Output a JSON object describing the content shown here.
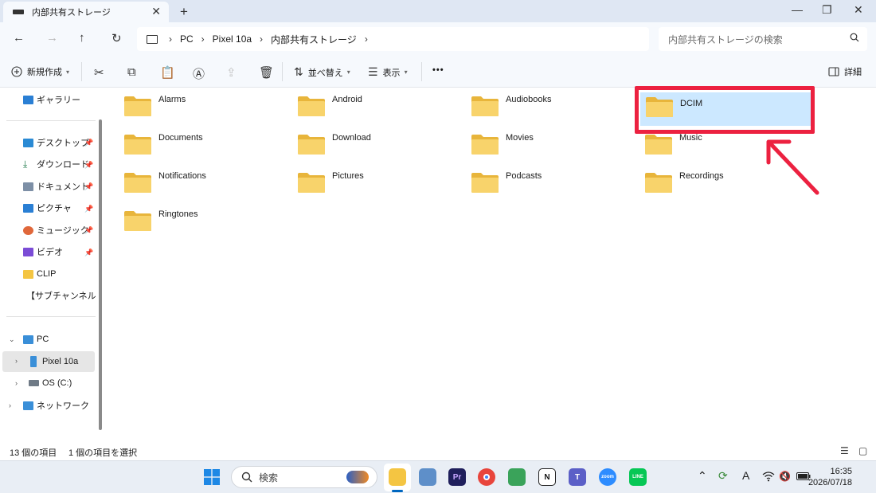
{
  "window": {
    "tab_title": "内部共有ストレージ",
    "new_tab_symbol": "+",
    "close_tab_symbol": "✕",
    "minimize_symbol": "—",
    "maximize_symbol": "❐",
    "close_window_symbol": "✕"
  },
  "nav": {
    "back": "←",
    "forward": "→",
    "up": "↑",
    "refresh": "↻",
    "breadcrumbs": [
      "PC",
      "Pixel 10a",
      "内部共有ストレージ"
    ],
    "sep": "›",
    "search_placeholder": "内部共有ストレージの検索"
  },
  "commands": {
    "new_label": "新規作成",
    "sort_label": "並べ替え",
    "view_label": "表示",
    "more": "•••",
    "details_label": "詳細"
  },
  "sidebar": {
    "gallery": "ギャラリー",
    "quick": [
      {
        "label": "デスクトップ",
        "icon": "desktop-folder-icon",
        "color": "#2a8ad4"
      },
      {
        "label": "ダウンロード",
        "icon": "download-arrow-icon",
        "color": "#1f7a4a"
      },
      {
        "label": "ドキュメント",
        "icon": "document-icon",
        "color": "#7d8fa6"
      },
      {
        "label": "ピクチャ",
        "icon": "pictures-icon",
        "color": "#2a7fd4"
      },
      {
        "label": "ミュージック",
        "icon": "music-icon",
        "color": "#e0673a"
      },
      {
        "label": "ビデオ",
        "icon": "video-icon",
        "color": "#7b4cd6"
      },
      {
        "label": "CLIP",
        "icon": "folder-icon",
        "color": "#f4c542"
      },
      {
        "label": "【サブチャンネル素材",
        "icon": "folder-icon",
        "color": "#f4c542"
      }
    ],
    "pc": "PC",
    "drives": [
      {
        "label": "Pixel 10a",
        "icon": "phone-icon"
      },
      {
        "label": "OS (C:)",
        "icon": "drive-icon"
      }
    ],
    "network": "ネットワーク",
    "pin_symbol": "📌"
  },
  "folders": [
    {
      "name": "Alarms"
    },
    {
      "name": "Android"
    },
    {
      "name": "Audiobooks"
    },
    {
      "name": "DCIM"
    },
    {
      "name": "Documents"
    },
    {
      "name": "Download"
    },
    {
      "name": "Movies"
    },
    {
      "name": "Music"
    },
    {
      "name": "Notifications"
    },
    {
      "name": "Pictures"
    },
    {
      "name": "Podcasts"
    },
    {
      "name": "Recordings"
    },
    {
      "name": "Ringtones"
    }
  ],
  "selected_folder": "DCIM",
  "status": {
    "item_count": "13 個の項目",
    "selected_count": "1 個の項目を選択"
  },
  "taskbar": {
    "search_label": "検索",
    "time": "16:35",
    "date": "2026/07/18",
    "ime": "A"
  },
  "colors": {
    "accent": "#0067c0",
    "selection": "#cce8ff",
    "annotation_red": "#ec2140",
    "folder_yellow": "#f8d36b"
  }
}
